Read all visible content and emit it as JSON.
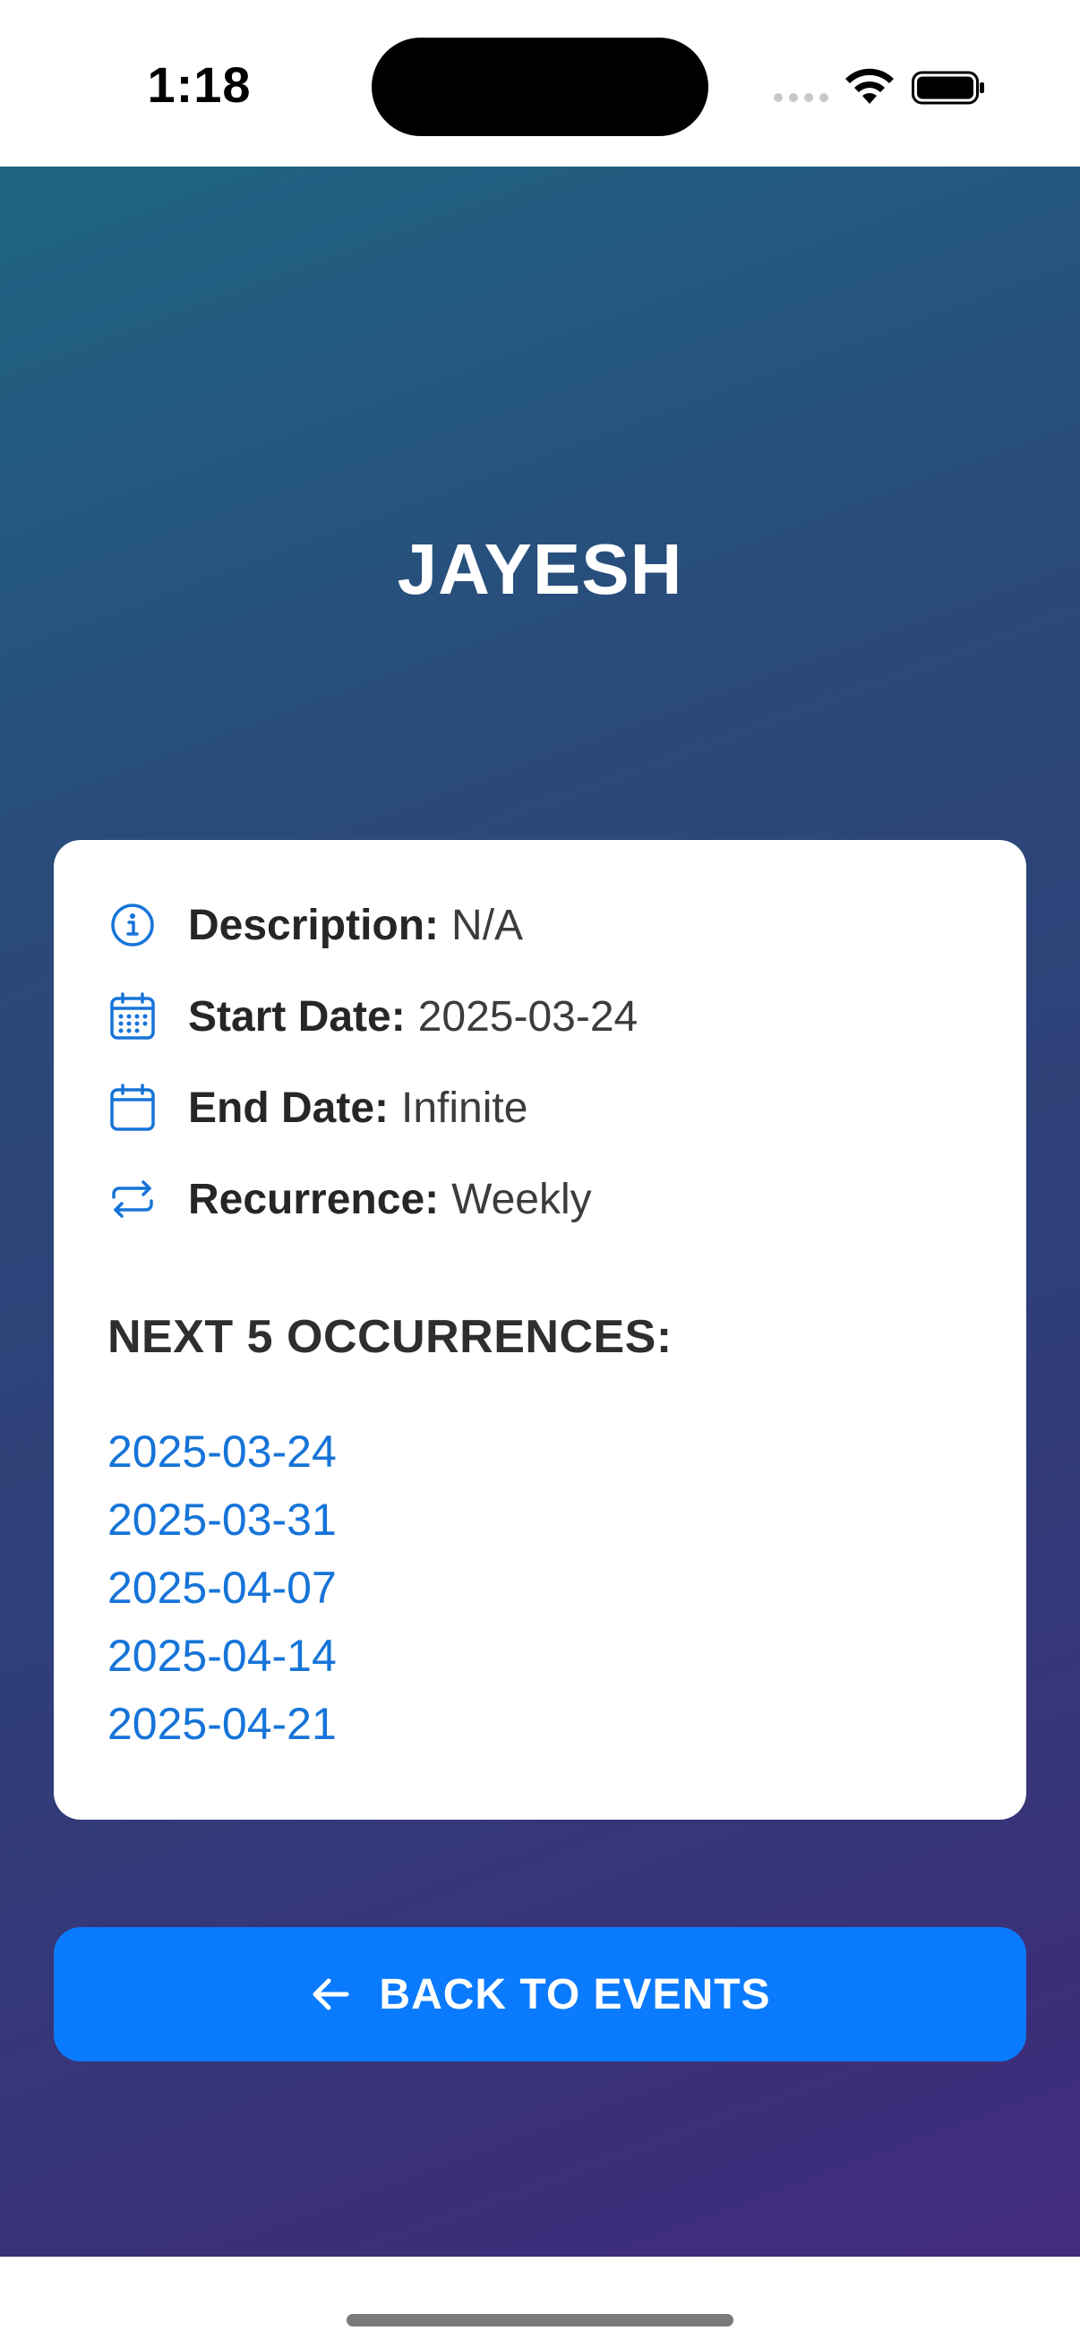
{
  "status_bar": {
    "time": "1:18"
  },
  "event": {
    "title": "JAYESH"
  },
  "details": [
    {
      "icon": "info-icon",
      "label": "Description:",
      "value": "N/A"
    },
    {
      "icon": "calendar-dots-icon",
      "label": "Start Date:",
      "value": "2025-03-24"
    },
    {
      "icon": "calendar-icon",
      "label": "End Date:",
      "value": "Infinite"
    },
    {
      "icon": "repeat-icon",
      "label": "Recurrence:",
      "value": "Weekly"
    }
  ],
  "occurrences": {
    "heading": "NEXT 5 OCCURRENCES:",
    "dates": [
      "2025-03-24",
      "2025-03-31",
      "2025-04-07",
      "2025-04-14",
      "2025-04-21"
    ]
  },
  "back_button": {
    "icon": "arrow-left-icon",
    "label": "BACK TO EVENTS"
  },
  "colors": {
    "accent": "#0a7bff",
    "link": "#1674d8",
    "gradient_start": "#1f6583",
    "gradient_end": "#432c7d"
  }
}
